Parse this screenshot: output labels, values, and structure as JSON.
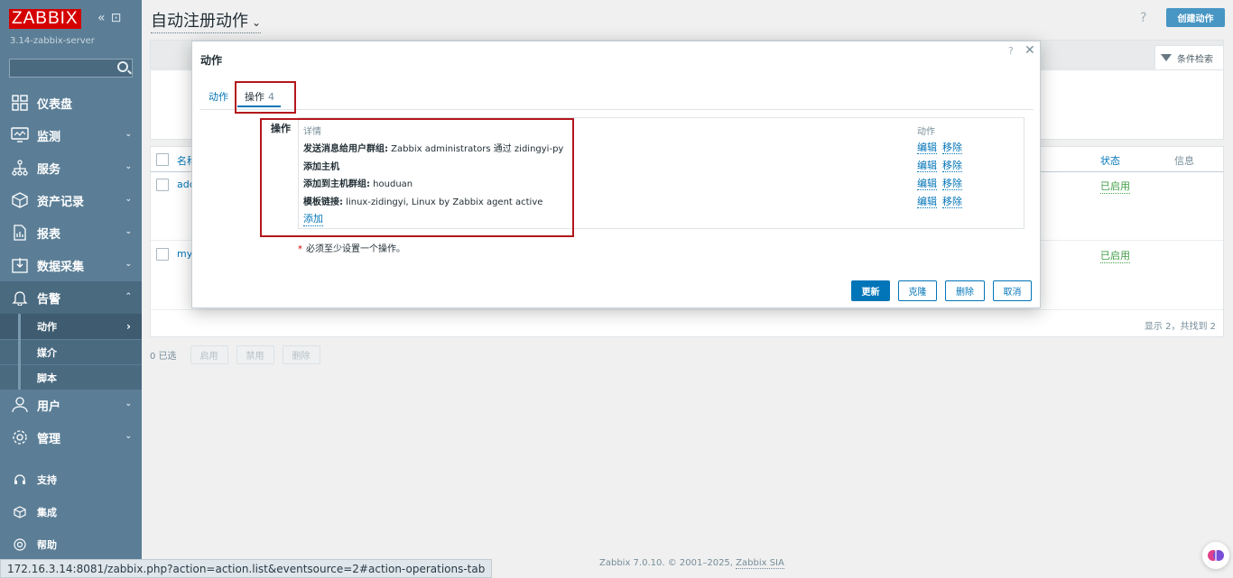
{
  "sidebar": {
    "logo": "ZABBIX",
    "server": "3.14-zabbix-server",
    "search_placeholder": "",
    "items": [
      {
        "label": "仪表盘",
        "icon": "dashboard-icon"
      },
      {
        "label": "监测",
        "icon": "monitoring-icon"
      },
      {
        "label": "服务",
        "icon": "services-icon"
      },
      {
        "label": "资产记录",
        "icon": "inventory-icon"
      },
      {
        "label": "报表",
        "icon": "reports-icon"
      },
      {
        "label": "数据采集",
        "icon": "data-collection-icon"
      },
      {
        "label": "告警",
        "icon": "alerts-icon"
      },
      {
        "label": "用户",
        "icon": "users-icon"
      },
      {
        "label": "管理",
        "icon": "administration-icon"
      }
    ],
    "sub_items": [
      "动作",
      "媒介",
      "脚本"
    ],
    "footer_items": [
      {
        "label": "支持",
        "icon": "support-icon"
      },
      {
        "label": "集成",
        "icon": "integrations-icon"
      },
      {
        "label": "帮助",
        "icon": "help-icon"
      }
    ]
  },
  "header": {
    "title": "自动注册动作",
    "help": "?",
    "create_button": "创建动作",
    "filter_tab": "条件检索"
  },
  "list": {
    "col_name": "名称",
    "col_status": "状态",
    "col_info": "信息",
    "rows": [
      {
        "name": "add",
        "status": "已启用"
      },
      {
        "name": "mys",
        "status": "已启用"
      }
    ],
    "summary": "显示 2，共找到 2"
  },
  "bulk": {
    "selected": "0 已选",
    "enable": "启用",
    "disable": "禁用",
    "delete": "删除"
  },
  "modal": {
    "title": "动作",
    "tab_action": "动作",
    "tab_operations": "操作",
    "tab_operations_count": "4",
    "ops_label": "操作",
    "col_details": "详情",
    "col_actions": "动作",
    "operations": [
      {
        "bold": "发送消息给用户群组:",
        "text": " Zabbix administrators 通过 zidingyi-py"
      },
      {
        "bold": "添加主机",
        "text": ""
      },
      {
        "bold": "添加到主机群组:",
        "text": " houduan"
      },
      {
        "bold": "模板链接:",
        "text": " linux-zidingyi, Linux by Zabbix agent active"
      }
    ],
    "edit": "编辑",
    "remove": "移除",
    "add": "添加",
    "required_note": "必须至少设置一个操作。",
    "buttons": {
      "update": "更新",
      "clone": "克隆",
      "delete": "删除",
      "cancel": "取消"
    }
  },
  "footer": {
    "text": "Zabbix 7.0.10. © 2001–2025, ",
    "company": "Zabbix SIA"
  },
  "statusbar": {
    "url": "172.16.3.14:8081/zabbix.php?action=action.list&eventsource=2#action-operations-tab"
  },
  "colors": {
    "sidebar": "#5b7e96",
    "brand": "#d40000",
    "accent": "#0275b8",
    "enabled": "#429e47",
    "highlight_box": "#b3171c"
  }
}
